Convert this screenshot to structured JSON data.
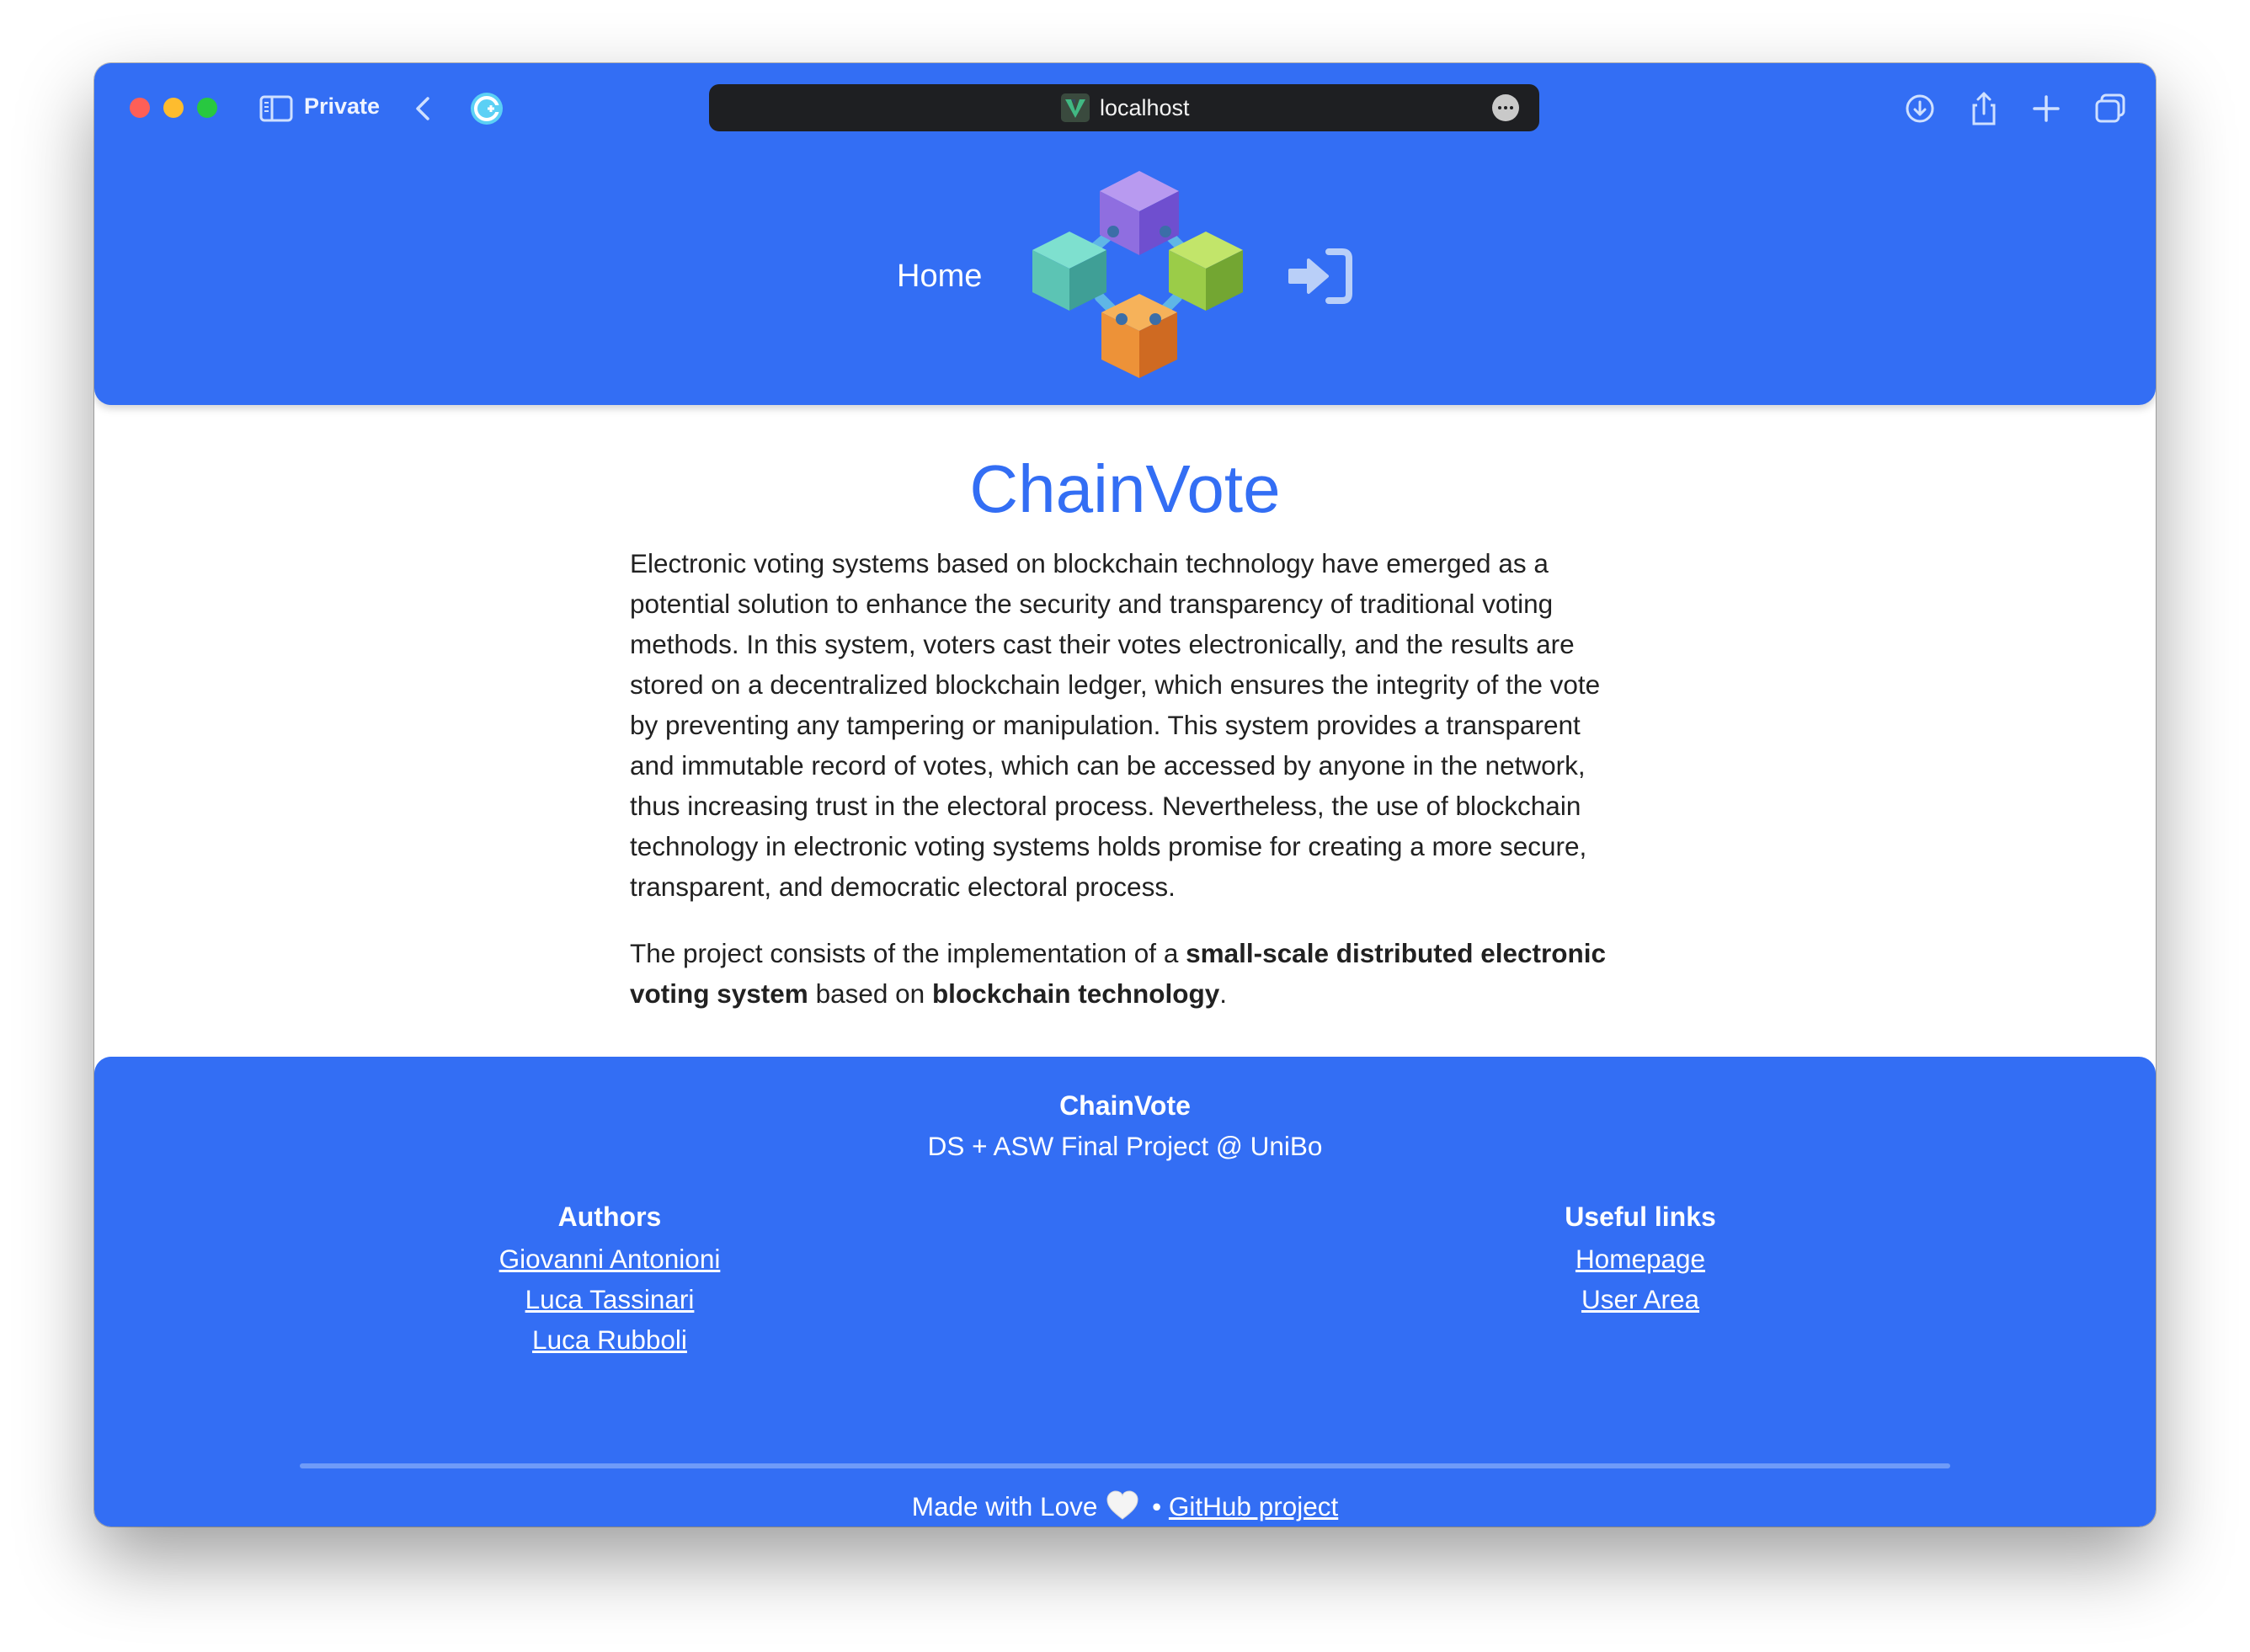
{
  "browser": {
    "private_label": "Private",
    "url": "localhost"
  },
  "header": {
    "nav_home": "Home",
    "logo_icon": "blockchain-cubes-logo",
    "login_icon": "sign-in-icon"
  },
  "main": {
    "title": "ChainVote",
    "intro": "Electronic voting systems based on blockchain technology have emerged as a potential solution to enhance the security and transparency of traditional voting methods. In this system, voters cast their votes electronically, and the results are stored on a decentralized blockchain ledger, which ensures the integrity of the vote by preventing any tampering or manipulation. This system provides a transparent and immutable record of votes, which can be accessed by anyone in the network, thus increasing trust in the electoral process. Nevertheless, the use of blockchain technology in electronic voting systems holds promise for creating a more secure, transparent, and democratic electoral process.",
    "project_prefix": "The project consists of the implementation of a ",
    "project_bold1": "small-scale distributed electronic voting system",
    "project_middle": " based on ",
    "project_bold2": "blockchain technology",
    "project_suffix": "."
  },
  "footer": {
    "title": "ChainVote",
    "subtitle": "DS + ASW Final Project @ UniBo",
    "authors_heading": "Authors",
    "authors": [
      "Giovanni Antonioni",
      "Luca Tassinari",
      "Luca Rubboli"
    ],
    "links_heading": "Useful links",
    "links": [
      "Homepage",
      "User Area"
    ],
    "made_with": "Made with Love",
    "separator": " • ",
    "github_link": "GitHub project"
  },
  "colors": {
    "brand_blue": "#336ef4",
    "text_dark": "#212121"
  }
}
